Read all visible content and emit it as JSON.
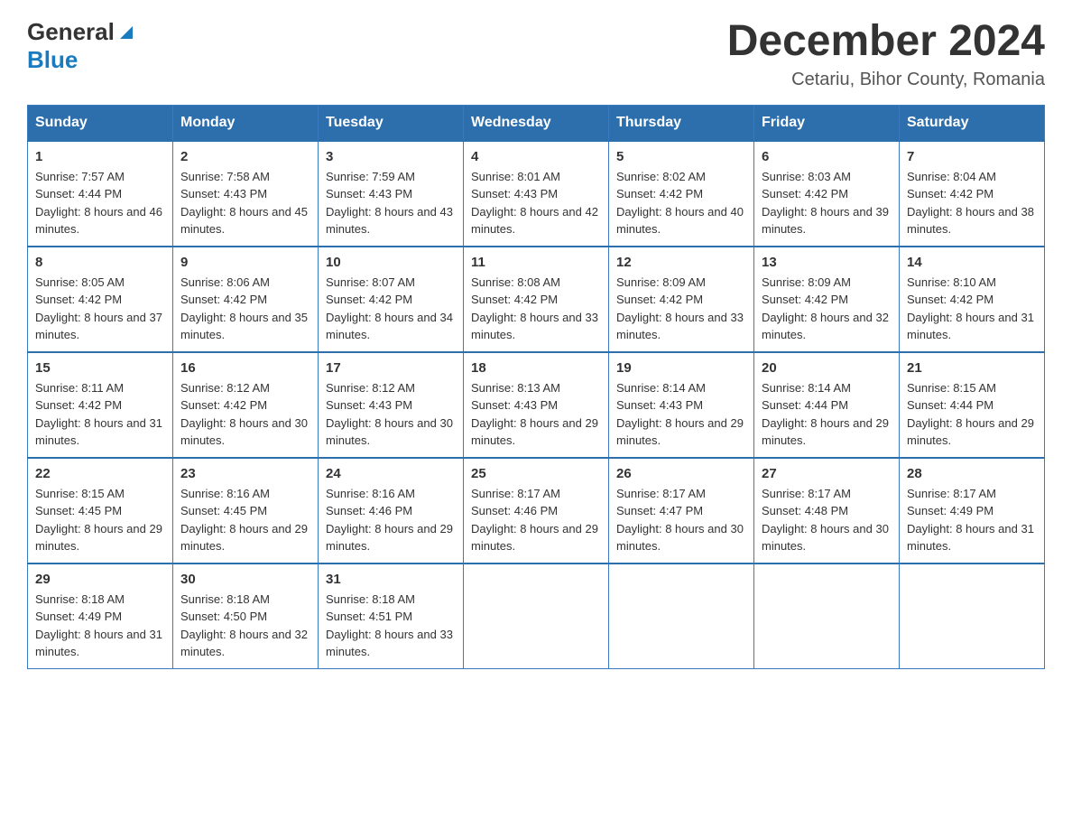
{
  "header": {
    "logo_general": "General",
    "logo_blue": "Blue",
    "month_title": "December 2024",
    "location": "Cetariu, Bihor County, Romania"
  },
  "days_of_week": [
    "Sunday",
    "Monday",
    "Tuesday",
    "Wednesday",
    "Thursday",
    "Friday",
    "Saturday"
  ],
  "weeks": [
    [
      {
        "day": "1",
        "sunrise": "7:57 AM",
        "sunset": "4:44 PM",
        "daylight": "8 hours and 46 minutes."
      },
      {
        "day": "2",
        "sunrise": "7:58 AM",
        "sunset": "4:43 PM",
        "daylight": "8 hours and 45 minutes."
      },
      {
        "day": "3",
        "sunrise": "7:59 AM",
        "sunset": "4:43 PM",
        "daylight": "8 hours and 43 minutes."
      },
      {
        "day": "4",
        "sunrise": "8:01 AM",
        "sunset": "4:43 PM",
        "daylight": "8 hours and 42 minutes."
      },
      {
        "day": "5",
        "sunrise": "8:02 AM",
        "sunset": "4:42 PM",
        "daylight": "8 hours and 40 minutes."
      },
      {
        "day": "6",
        "sunrise": "8:03 AM",
        "sunset": "4:42 PM",
        "daylight": "8 hours and 39 minutes."
      },
      {
        "day": "7",
        "sunrise": "8:04 AM",
        "sunset": "4:42 PM",
        "daylight": "8 hours and 38 minutes."
      }
    ],
    [
      {
        "day": "8",
        "sunrise": "8:05 AM",
        "sunset": "4:42 PM",
        "daylight": "8 hours and 37 minutes."
      },
      {
        "day": "9",
        "sunrise": "8:06 AM",
        "sunset": "4:42 PM",
        "daylight": "8 hours and 35 minutes."
      },
      {
        "day": "10",
        "sunrise": "8:07 AM",
        "sunset": "4:42 PM",
        "daylight": "8 hours and 34 minutes."
      },
      {
        "day": "11",
        "sunrise": "8:08 AM",
        "sunset": "4:42 PM",
        "daylight": "8 hours and 33 minutes."
      },
      {
        "day": "12",
        "sunrise": "8:09 AM",
        "sunset": "4:42 PM",
        "daylight": "8 hours and 33 minutes."
      },
      {
        "day": "13",
        "sunrise": "8:09 AM",
        "sunset": "4:42 PM",
        "daylight": "8 hours and 32 minutes."
      },
      {
        "day": "14",
        "sunrise": "8:10 AM",
        "sunset": "4:42 PM",
        "daylight": "8 hours and 31 minutes."
      }
    ],
    [
      {
        "day": "15",
        "sunrise": "8:11 AM",
        "sunset": "4:42 PM",
        "daylight": "8 hours and 31 minutes."
      },
      {
        "day": "16",
        "sunrise": "8:12 AM",
        "sunset": "4:42 PM",
        "daylight": "8 hours and 30 minutes."
      },
      {
        "day": "17",
        "sunrise": "8:12 AM",
        "sunset": "4:43 PM",
        "daylight": "8 hours and 30 minutes."
      },
      {
        "day": "18",
        "sunrise": "8:13 AM",
        "sunset": "4:43 PM",
        "daylight": "8 hours and 29 minutes."
      },
      {
        "day": "19",
        "sunrise": "8:14 AM",
        "sunset": "4:43 PM",
        "daylight": "8 hours and 29 minutes."
      },
      {
        "day": "20",
        "sunrise": "8:14 AM",
        "sunset": "4:44 PM",
        "daylight": "8 hours and 29 minutes."
      },
      {
        "day": "21",
        "sunrise": "8:15 AM",
        "sunset": "4:44 PM",
        "daylight": "8 hours and 29 minutes."
      }
    ],
    [
      {
        "day": "22",
        "sunrise": "8:15 AM",
        "sunset": "4:45 PM",
        "daylight": "8 hours and 29 minutes."
      },
      {
        "day": "23",
        "sunrise": "8:16 AM",
        "sunset": "4:45 PM",
        "daylight": "8 hours and 29 minutes."
      },
      {
        "day": "24",
        "sunrise": "8:16 AM",
        "sunset": "4:46 PM",
        "daylight": "8 hours and 29 minutes."
      },
      {
        "day": "25",
        "sunrise": "8:17 AM",
        "sunset": "4:46 PM",
        "daylight": "8 hours and 29 minutes."
      },
      {
        "day": "26",
        "sunrise": "8:17 AM",
        "sunset": "4:47 PM",
        "daylight": "8 hours and 30 minutes."
      },
      {
        "day": "27",
        "sunrise": "8:17 AM",
        "sunset": "4:48 PM",
        "daylight": "8 hours and 30 minutes."
      },
      {
        "day": "28",
        "sunrise": "8:17 AM",
        "sunset": "4:49 PM",
        "daylight": "8 hours and 31 minutes."
      }
    ],
    [
      {
        "day": "29",
        "sunrise": "8:18 AM",
        "sunset": "4:49 PM",
        "daylight": "8 hours and 31 minutes."
      },
      {
        "day": "30",
        "sunrise": "8:18 AM",
        "sunset": "4:50 PM",
        "daylight": "8 hours and 32 minutes."
      },
      {
        "day": "31",
        "sunrise": "8:18 AM",
        "sunset": "4:51 PM",
        "daylight": "8 hours and 33 minutes."
      },
      null,
      null,
      null,
      null
    ]
  ]
}
